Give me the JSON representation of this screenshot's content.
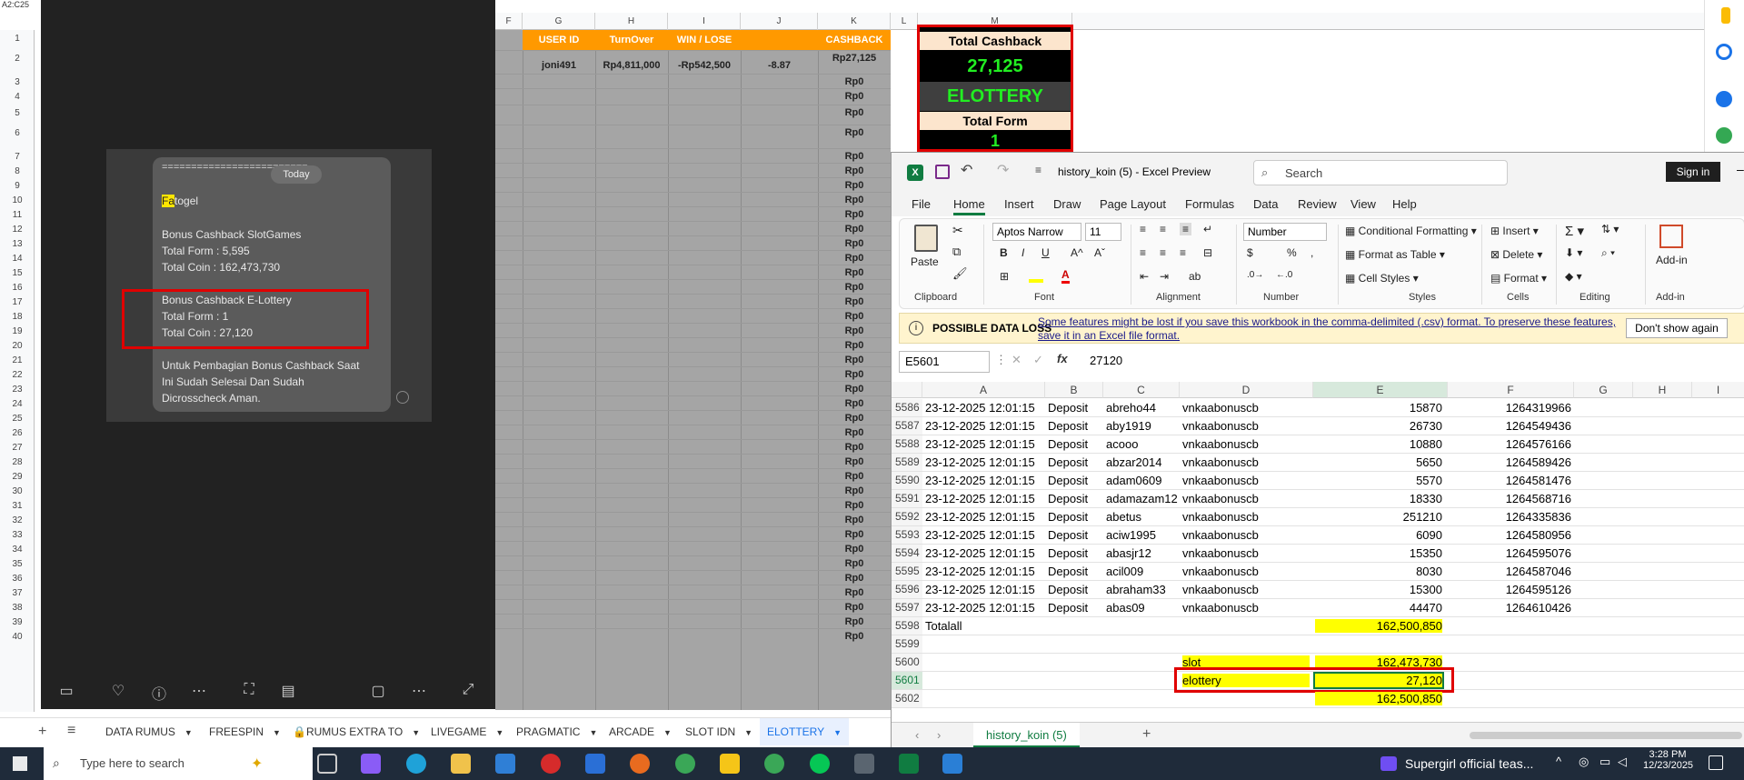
{
  "gsheet": {
    "name_box": "A2:C25",
    "col_headers": [
      "F",
      "G",
      "H",
      "I",
      "J",
      "K",
      "L",
      "M"
    ],
    "headers": {
      "user_id": "USER ID",
      "turnover": "TurnOver",
      "winlose": "WIN / LOSE",
      "cashback": "CASHBACK"
    },
    "data_row": {
      "user": "joni491",
      "turnover": "Rp4,811,000",
      "winlose": "-Rp542,500",
      "pct": "-8.87",
      "cashback": "Rp27,125"
    },
    "zero_value": "Rp0",
    "row_numbers": [
      "1",
      "2",
      "3",
      "4",
      "5",
      "6",
      "7",
      "8",
      "9",
      "10",
      "11",
      "12",
      "13",
      "14",
      "15",
      "16",
      "17",
      "18",
      "19",
      "20",
      "21",
      "22",
      "23",
      "24",
      "25",
      "26",
      "27",
      "28",
      "29",
      "30",
      "31",
      "32",
      "33",
      "34",
      "35",
      "36",
      "37",
      "38",
      "39",
      "40"
    ],
    "summary": {
      "total_cashback_label": "Total Cashback",
      "total_cashback_value": "27,125",
      "category": "ELOTTERY",
      "total_form_label": "Total Form",
      "total_form_value": "1"
    },
    "tabs": [
      "DATA RUMUS",
      "FREESPIN",
      "RUMUS EXTRA TO",
      "LIVEGAME",
      "PRAGMATIC",
      "ARCADE",
      "SLOT IDN",
      "ELOTTERY"
    ],
    "active_tab": "ELOTTERY"
  },
  "viewer": {
    "today": "Today",
    "separator": "=========================",
    "brand_hl": "Fa",
    "brand_rest": "togel",
    "slot_title": "Bonus Cashback SlotGames",
    "slot_form": "Total Form : 5,595",
    "slot_coin": "Total Coin : 162,473,730",
    "elot_title": "Bonus Cashback E-Lottery",
    "elot_form": "Total Form : 1",
    "elot_coin": "Total Coin : 27,120",
    "footer1": "Untuk Pembagian Bonus Cashback Saat",
    "footer2": "Ini Sudah Selesai Dan Sudah",
    "footer3": "Dicrosscheck Aman."
  },
  "excel": {
    "filename": "history_koin (5)  -  Excel Preview",
    "search_placeholder": "Search",
    "sign_in": "Sign in",
    "menu": [
      "File",
      "Home",
      "Insert",
      "Draw",
      "Page Layout",
      "Formulas",
      "Data",
      "Review",
      "View",
      "Help"
    ],
    "active_menu": "Home",
    "ribbon": {
      "paste": "Paste",
      "clipboard": "Clipboard",
      "font_name": "Aptos Narrow",
      "font_size": "11",
      "font": "Font",
      "alignment": "Alignment",
      "number_format": "Number",
      "number": "Number",
      "cond_format": "Conditional Formatting",
      "format_table": "Format as Table",
      "cell_styles": "Cell Styles",
      "styles": "Styles",
      "insert": "Insert",
      "delete": "Delete",
      "format": "Format",
      "cells": "Cells",
      "editing": "Editing",
      "addins": "Add-in",
      "addins2": "Add-in"
    },
    "warning": {
      "label": "POSSIBLE DATA LOSS",
      "message1": "Some features might be lost if you save this workbook in the comma-delimited (.csv) format. To preserve these features,",
      "message2": "save it in an Excel file format.",
      "button": "Don't show again"
    },
    "name_box": "E5601",
    "formula": "27120",
    "col_headers": [
      "A",
      "B",
      "C",
      "D",
      "E",
      "F",
      "G",
      "H",
      "I"
    ],
    "rows": [
      {
        "n": "5586",
        "a": "23-12-2025 12:01:15",
        "b": "Deposit",
        "c": "abreho44",
        "d": "vnkaabonuscb",
        "e": "15870",
        "f": "1264319966"
      },
      {
        "n": "5587",
        "a": "23-12-2025 12:01:15",
        "b": "Deposit",
        "c": "aby1919",
        "d": "vnkaabonuscb",
        "e": "26730",
        "f": "1264549436"
      },
      {
        "n": "5588",
        "a": "23-12-2025 12:01:15",
        "b": "Deposit",
        "c": "acooo",
        "d": "vnkaabonuscb",
        "e": "10880",
        "f": "1264576166"
      },
      {
        "n": "5589",
        "a": "23-12-2025 12:01:15",
        "b": "Deposit",
        "c": "abzar2014",
        "d": "vnkaabonuscb",
        "e": "5650",
        "f": "1264589426"
      },
      {
        "n": "5590",
        "a": "23-12-2025 12:01:15",
        "b": "Deposit",
        "c": "adam0609",
        "d": "vnkaabonuscb",
        "e": "5570",
        "f": "1264581476"
      },
      {
        "n": "5591",
        "a": "23-12-2025 12:01:15",
        "b": "Deposit",
        "c": "adamazam12",
        "d": "vnkaabonuscb",
        "e": "18330",
        "f": "1264568716"
      },
      {
        "n": "5592",
        "a": "23-12-2025 12:01:15",
        "b": "Deposit",
        "c": "abetus",
        "d": "vnkaabonuscb",
        "e": "251210",
        "f": "1264335836"
      },
      {
        "n": "5593",
        "a": "23-12-2025 12:01:15",
        "b": "Deposit",
        "c": "aciw1995",
        "d": "vnkaabonuscb",
        "e": "6090",
        "f": "1264580956"
      },
      {
        "n": "5594",
        "a": "23-12-2025 12:01:15",
        "b": "Deposit",
        "c": "abasjr12",
        "d": "vnkaabonuscb",
        "e": "15350",
        "f": "1264595076"
      },
      {
        "n": "5595",
        "a": "23-12-2025 12:01:15",
        "b": "Deposit",
        "c": "acil009",
        "d": "vnkaabonuscb",
        "e": "8030",
        "f": "1264587046"
      },
      {
        "n": "5596",
        "a": "23-12-2025 12:01:15",
        "b": "Deposit",
        "c": "abraham33",
        "d": "vnkaabonuscb",
        "e": "15300",
        "f": "1264595126"
      },
      {
        "n": "5597",
        "a": "23-12-2025 12:01:15",
        "b": "Deposit",
        "c": "abas09",
        "d": "vnkaabonuscb",
        "e": "44470",
        "f": "1264610426"
      }
    ],
    "total_row": {
      "n": "5598",
      "label": "Totalall",
      "value": "162,500,850"
    },
    "row_5599": "5599",
    "slot_row": {
      "n": "5600",
      "label": "slot",
      "value": "162,473,730"
    },
    "elot_row": {
      "n": "5601",
      "label": "elottery",
      "value": "27,120"
    },
    "sum_row": {
      "n": "5602",
      "value": "162,500,850"
    },
    "sheet_tab": "history_koin (5)"
  },
  "taskbar": {
    "search_placeholder": "Type here to search",
    "media": "Supergirl official teas...",
    "time": "3:28 PM",
    "date": "12/23/2025"
  }
}
